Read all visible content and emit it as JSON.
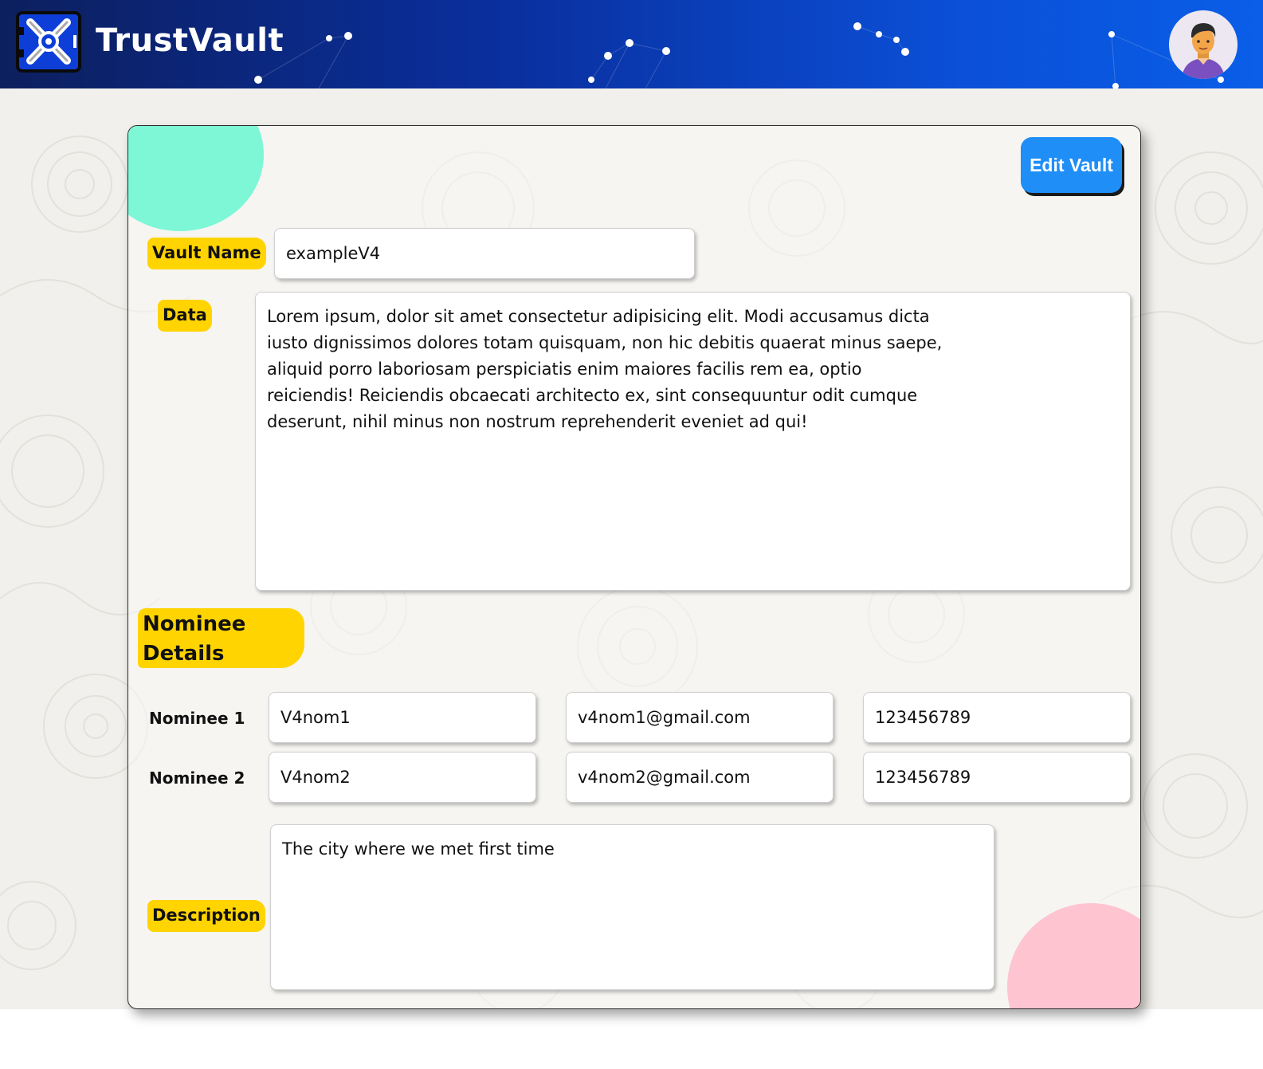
{
  "header": {
    "brand": "TrustVault",
    "logo_icon": "vault-x-icon",
    "avatar_icon": "user-avatar-icon"
  },
  "colors": {
    "header_start": "#0c1f5e",
    "header_end": "#0a5ee8",
    "accent_button": "#1f8ef7",
    "label_yellow": "#ffd400",
    "blob_teal": "#7df7d6",
    "blob_pink": "#fec4d0"
  },
  "vault": {
    "edit_button": "Edit Vault",
    "name_label": "Vault Name",
    "name_value": "exampleV4",
    "data_label": "Data",
    "data_value": "Lorem ipsum, dolor sit amet consectetur adipisicing elit. Modi accusamus dicta\niusto dignissimos dolores totam quisquam, non hic debitis quaerat minus saepe,\naliquid porro laboriosam perspiciatis enim maiores facilis rem ea, optio\nreiciendis! Reiciendis obcaecati architecto ex, sint consequuntur odit cumque\ndeserunt, nihil minus non nostrum reprehenderit eveniet ad qui!"
  },
  "nominees": {
    "section_title": "Nominee Details",
    "rows": [
      {
        "label": "Nominee 1",
        "name": "V4nom1",
        "email": "v4nom1@gmail.com",
        "phone": "123456789"
      },
      {
        "label": "Nominee 2",
        "name": "V4nom2",
        "email": "v4nom2@gmail.com",
        "phone": "123456789"
      }
    ]
  },
  "description": {
    "label": "Description",
    "value": "The city where we met first time"
  }
}
